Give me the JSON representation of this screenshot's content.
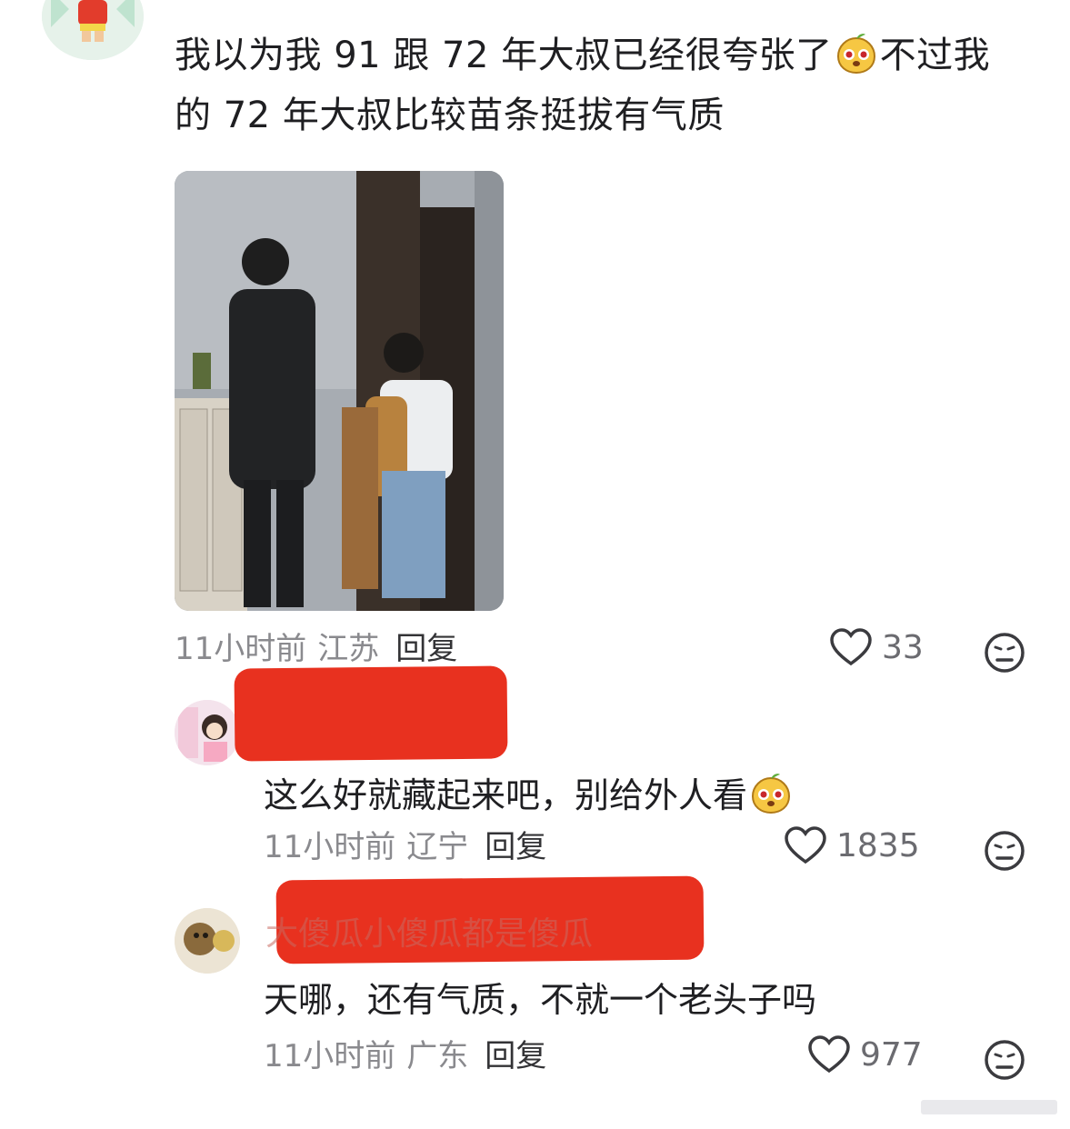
{
  "comment_main": {
    "text_line1_a": "我以为我 91 跟 72 年大叔已经很夸张了",
    "text_line1_b": "不过我",
    "text_line2": "的 72 年大叔比较苗条挺拔有气质",
    "meta": {
      "time": "11小时前",
      "region": "江苏",
      "reply_label": "回复"
    },
    "likes": "33",
    "emoji_name": "yellow-pear-emoji-icon"
  },
  "reply_1": {
    "text": "这么好就藏起来吧，别给外人看",
    "meta": {
      "time": "11小时前",
      "region": "辽宁",
      "reply_label": "回复"
    },
    "likes": "1835"
  },
  "reply_2": {
    "username": "大傻瓜小傻瓜都是傻瓜",
    "text": "天哪，还有气质，不就一个老头子吗",
    "meta": {
      "time": "11小时前",
      "region": "广东",
      "reply_label": "回复"
    },
    "likes": "977"
  },
  "icons": {
    "like": "heart-outline-icon",
    "dislike": "meh-face-icon"
  },
  "colors": {
    "redaction": "#e8311f",
    "meta_gray": "#8a8a8e"
  }
}
